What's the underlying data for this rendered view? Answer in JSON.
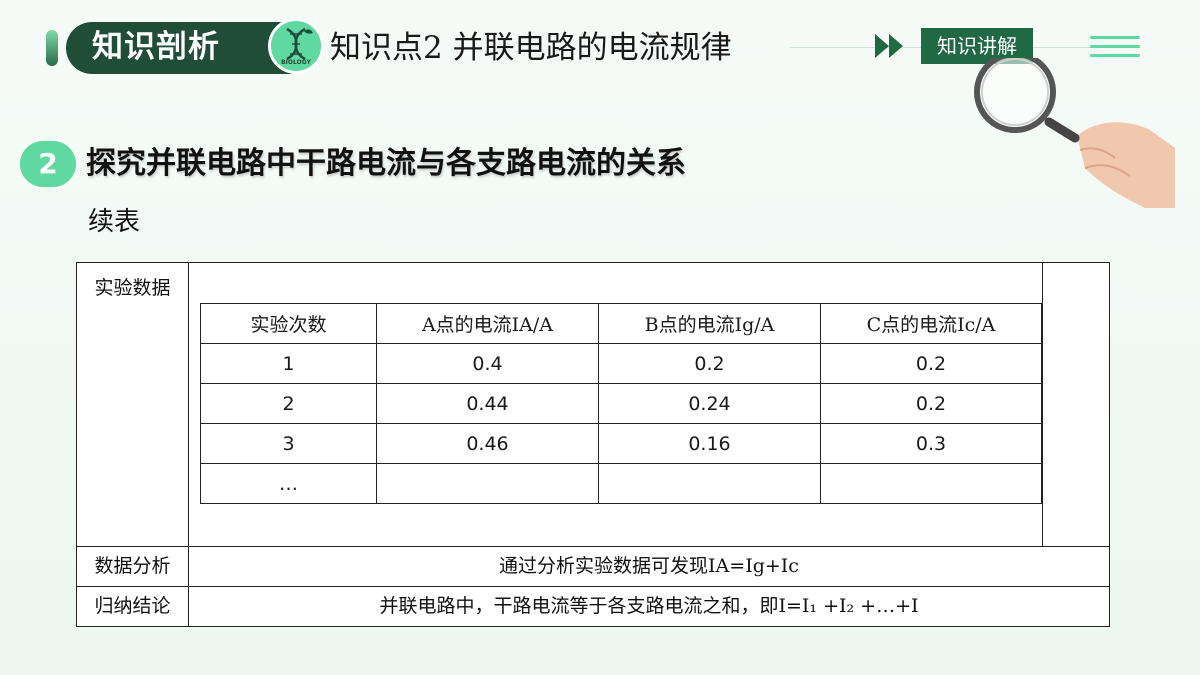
{
  "header": {
    "badge_label": "知识剖析",
    "logo_text": "BIOLOGY",
    "title": "知识点2 并联电路的电流规律",
    "tag_label": "知识讲解"
  },
  "section": {
    "number": "2",
    "title": "探究并联电路中干路电流与各支路电流的关系",
    "continued_label": "续表"
  },
  "table": {
    "rows": {
      "data_label": "实验数据",
      "analysis_label": "数据分析",
      "analysis_text": "通过分析实验数据可发现IA=Ig+Ic",
      "conclusion_label": "归纳结论",
      "conclusion_text": "并联电路中，干路电流等于各支路电流之和，即I=I₁ +I₂ +…+I"
    },
    "headers": [
      "实验次数",
      "A点的电流IA/A",
      "B点的电流Ig/A",
      "C点的电流Ic/A"
    ],
    "data_rows": [
      [
        "1",
        "0.4",
        "0.2",
        "0.2"
      ],
      [
        "2",
        "0.44",
        "0.24",
        "0.2"
      ],
      [
        "3",
        "0.46",
        "0.16",
        "0.3"
      ],
      [
        "…",
        "",
        "",
        ""
      ]
    ]
  },
  "colors": {
    "accent": "#5fd8a1",
    "dark_green": "#1f4d38",
    "tag_green": "#1f6a45"
  }
}
